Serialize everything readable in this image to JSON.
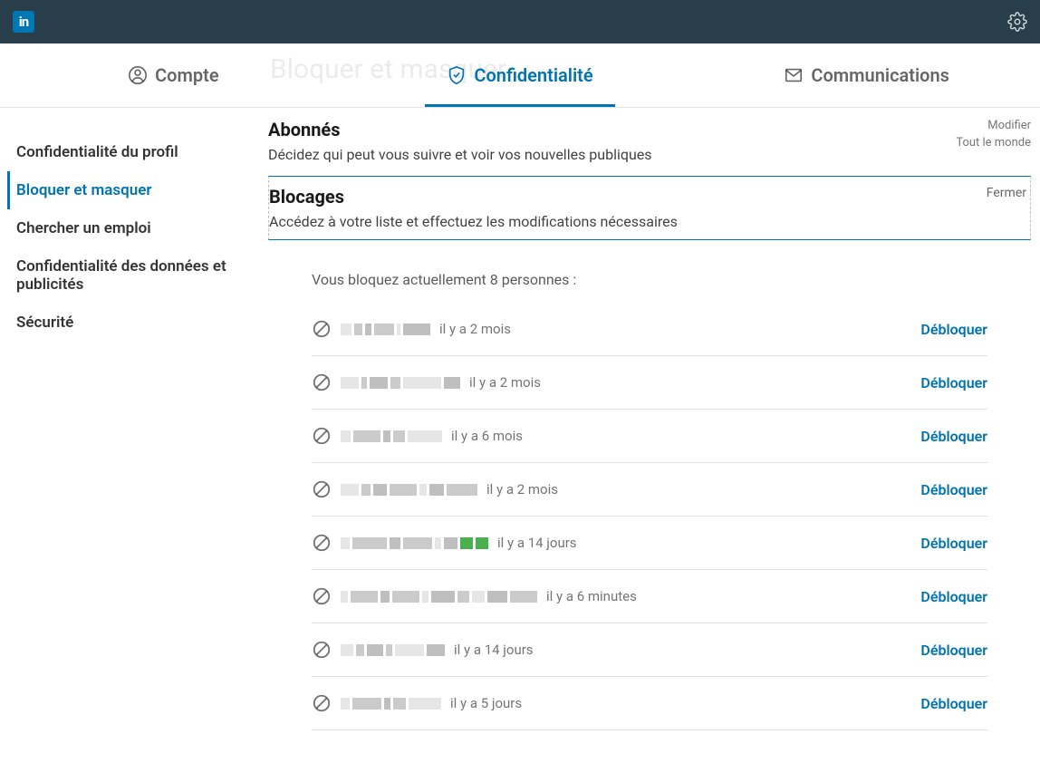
{
  "header": {
    "logo": "in"
  },
  "tabs": {
    "account": "Compte",
    "privacy": "Confidentialité",
    "communications": "Communications"
  },
  "ghost_title": "Bloquer et masquer",
  "sidebar": {
    "items": [
      {
        "label": "Confidentialité du profil"
      },
      {
        "label": "Bloquer et masquer"
      },
      {
        "label": "Chercher un emploi"
      },
      {
        "label": "Confidentialité des données et publicités"
      },
      {
        "label": "Sécurité"
      }
    ]
  },
  "followers": {
    "title": "Abonnés",
    "desc": "Décidez qui peut vous suivre et voir vos nouvelles publiques",
    "modify": "Modifier",
    "value": "Tout le monde"
  },
  "blocking": {
    "title": "Blocages",
    "desc": "Accédez à votre liste et effectuez les modifications nécessaires",
    "close": "Fermer",
    "list_intro": "Vous bloquez actuellement 8 personnes :",
    "unblock_label": "Débloquer",
    "entries": [
      {
        "time": "il y a 2 mois",
        "widths": [
          12,
          9,
          7,
          22,
          4,
          30
        ],
        "green": []
      },
      {
        "time": "il y a 2 mois",
        "widths": [
          20,
          6,
          20,
          11,
          42,
          18
        ],
        "green": []
      },
      {
        "time": "il y a 6 mois",
        "widths": [
          11,
          30,
          8,
          13,
          38
        ],
        "green": []
      },
      {
        "time": "il y a 2 mois",
        "widths": [
          20,
          10,
          15,
          30,
          8,
          16,
          34
        ],
        "green": []
      },
      {
        "time": "il y a 14 jours",
        "widths": [
          10,
          38,
          12,
          32,
          7,
          15,
          14,
          14
        ],
        "green": [
          6,
          7
        ]
      },
      {
        "time": "il y a 6 minutes",
        "widths": [
          8,
          30,
          10,
          30,
          7,
          26,
          13,
          14,
          22,
          30
        ],
        "green": []
      },
      {
        "time": "il y a 14 jours",
        "widths": [
          14,
          9,
          18,
          7,
          32,
          20
        ],
        "green": []
      },
      {
        "time": "il y a 5 jours",
        "widths": [
          10,
          32,
          7,
          14,
          36
        ],
        "green": []
      }
    ]
  }
}
